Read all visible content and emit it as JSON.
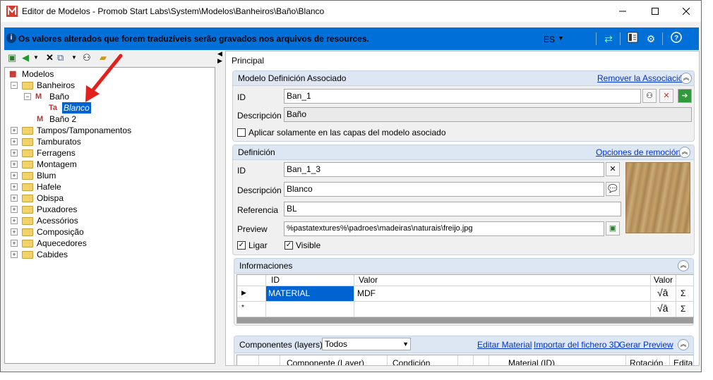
{
  "window": {
    "title": "Editor de Modelos - Promob Start Labs\\System\\Modelos\\Banheiros\\Baño\\Blanco",
    "minimize_icon": "minimize-icon",
    "maximize_icon": "maximize-icon",
    "close_icon": "close-icon"
  },
  "infobar": {
    "message": "Os valores alterados que forem traduzíveis serão gravados nos arquivos de resources.",
    "language": "ES"
  },
  "tree": {
    "root": "Modelos",
    "banheiros": "Banheiros",
    "bano": "Baño",
    "blanco": "Blanco",
    "bano2": "Baño 2",
    "folders": [
      "Tampos/Tamponamentos",
      "Tamburatos",
      "Ferragens",
      "Montagem",
      "Blum",
      "Hafele",
      "Obispa",
      "Puxadores",
      "Acessórios",
      "Composição",
      "Aquecedores",
      "Cabides"
    ]
  },
  "main": {
    "tab": "Principal",
    "associated": {
      "title": "Modelo Definición Associado",
      "remove_link": "Remover la Associación",
      "id_label": "ID",
      "id_value": "Ban_1",
      "desc_label": "Descripción",
      "desc_value": "Baño",
      "apply_only_label": "Aplicar solamente en las capas del modelo asociado"
    },
    "definition": {
      "title": "Definición",
      "options_link": "Opciones de remoción",
      "id_label": "ID",
      "id_value": "Ban_1_3",
      "desc_label": "Descripción",
      "desc_value": "Blanco",
      "ref_label": "Referencia",
      "ref_value": "BL",
      "preview_label": "Preview",
      "preview_value": "%pastatextures%\\padroes\\madeiras\\naturais\\freijo.jpg",
      "ligar_label": "Ligar",
      "visible_label": "Visible"
    },
    "info": {
      "title": "Informaciones",
      "columns": [
        "ID",
        "Valor",
        "Valor"
      ],
      "rows": [
        {
          "id": "MATERIAL",
          "value": "MDF"
        }
      ]
    },
    "components": {
      "title": "Componentes (layers)",
      "filter": "Todos",
      "edit_material": "Editar Material",
      "import_3d": "Importar del fichero 3D",
      "gen_preview": "Gerar Preview",
      "columns": [
        "Componente (Layer)",
        "Condición",
        "Material (ID)",
        "Rotación",
        "Editar"
      ]
    }
  },
  "colors": {
    "infobar": "#0070d8",
    "selection": "#0063d2",
    "link": "#0033cc",
    "annotation_arrow": "#e3201b"
  }
}
